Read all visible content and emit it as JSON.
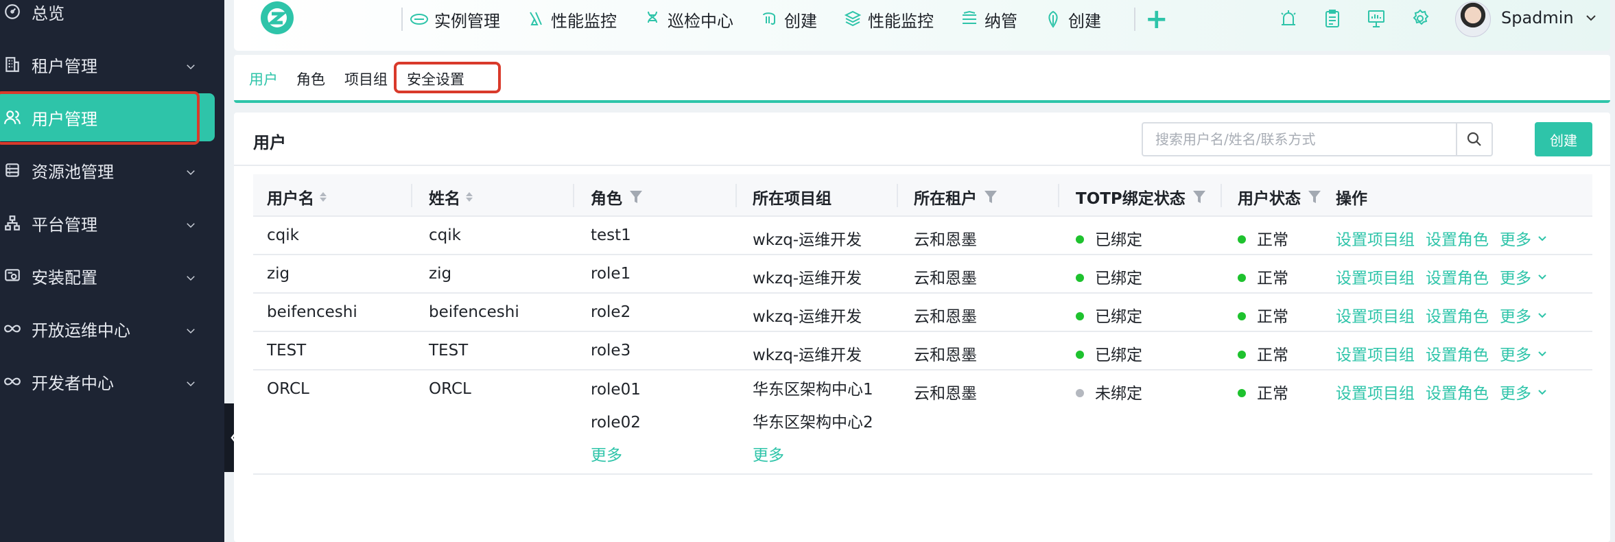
{
  "sidebar": {
    "items": [
      {
        "label": "总览",
        "icon": "dashboard-icon",
        "has_chevron": false
      },
      {
        "label": "租户管理",
        "icon": "building-icon",
        "has_chevron": true
      },
      {
        "label": "用户管理",
        "icon": "users-icon",
        "has_chevron": false,
        "active": true
      },
      {
        "label": "资源池管理",
        "icon": "database-icon",
        "has_chevron": true
      },
      {
        "label": "平台管理",
        "icon": "sitemap-icon",
        "has_chevron": true
      },
      {
        "label": "安装配置",
        "icon": "config-icon",
        "has_chevron": true
      },
      {
        "label": "开放运维中心",
        "icon": "infinity-icon",
        "has_chevron": true
      },
      {
        "label": "开发者中心",
        "icon": "infinity-icon",
        "has_chevron": true
      }
    ]
  },
  "topnav": {
    "items": [
      {
        "label": "实例管理",
        "icon": "orcl-icon"
      },
      {
        "label": "性能监控",
        "icon": "probe-icon"
      },
      {
        "label": "巡检中心",
        "icon": "dna-icon"
      },
      {
        "label": "创建",
        "icon": "elephant-icon"
      },
      {
        "label": "性能监控",
        "icon": "layers-icon"
      },
      {
        "label": "纳管",
        "icon": "stack-icon"
      },
      {
        "label": "创建",
        "icon": "leaf-icon"
      }
    ],
    "plus": "+",
    "tools": [
      "alarm-icon",
      "clipboard-icon",
      "monitor-icon",
      "gear-icon"
    ],
    "user": "Spadmin"
  },
  "subtabs": [
    {
      "label": "用户",
      "active": true
    },
    {
      "label": "角色"
    },
    {
      "label": "项目组"
    },
    {
      "label": "安全设置"
    }
  ],
  "card": {
    "title": "用户",
    "search_placeholder": "搜索用户名/姓名/联系方式",
    "create_label": "创建"
  },
  "table": {
    "headers": [
      "用户名",
      "姓名",
      "角色",
      "所在项目组",
      "所在租户",
      "TOTP绑定状态",
      "用户状态",
      "操作"
    ],
    "rows": [
      {
        "username": "cqik",
        "name": "cqik",
        "roles": [
          "test1"
        ],
        "groups": [
          "wkzq-运维开发"
        ],
        "tenant": "云和恩墨",
        "totp": "已绑定",
        "totp_color": "#1ec22e",
        "status": "正常",
        "status_color": "#1ec22e"
      },
      {
        "username": "zig",
        "name": "zig",
        "roles": [
          "role1"
        ],
        "groups": [
          "wkzq-运维开发"
        ],
        "tenant": "云和恩墨",
        "totp": "已绑定",
        "totp_color": "#1ec22e",
        "status": "正常",
        "status_color": "#1ec22e"
      },
      {
        "username": "beifenceshi",
        "name": "beifenceshi",
        "roles": [
          "role2"
        ],
        "groups": [
          "wkzq-运维开发"
        ],
        "tenant": "云和恩墨",
        "totp": "已绑定",
        "totp_color": "#1ec22e",
        "status": "正常",
        "status_color": "#1ec22e"
      },
      {
        "username": "TEST",
        "name": "TEST",
        "roles": [
          "role3"
        ],
        "groups": [
          "wkzq-运维开发"
        ],
        "tenant": "云和恩墨",
        "totp": "已绑定",
        "totp_color": "#1ec22e",
        "status": "正常",
        "status_color": "#1ec22e"
      },
      {
        "username": "ORCL",
        "name": "ORCL",
        "roles": [
          "role01",
          "role02"
        ],
        "groups": [
          "华东区架构中心1",
          "华东区架构中心2"
        ],
        "tenant": "云和恩墨",
        "totp": "未绑定",
        "totp_color": "#b4b8bf",
        "status": "正常",
        "status_color": "#1ec22e",
        "more_label": "更多"
      }
    ],
    "ops": {
      "set_group": "设置项目组",
      "set_role": "设置角色",
      "more": "更多"
    }
  },
  "colors": {
    "accent": "#2ec4a9",
    "sidebar_bg": "#1d2433",
    "highlight": "#d93a2b"
  }
}
